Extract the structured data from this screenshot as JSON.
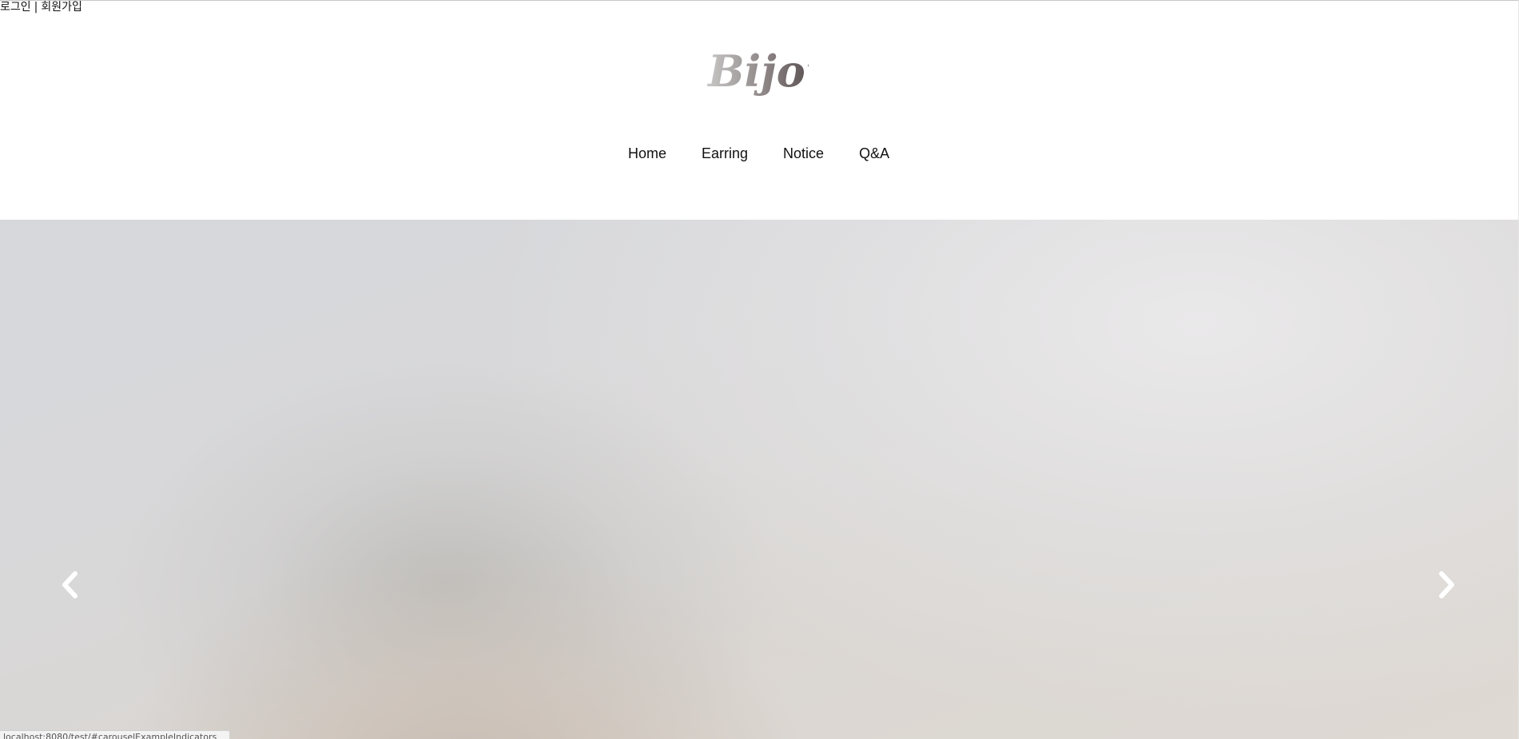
{
  "auth": {
    "login_label": "로그인",
    "separator": "|",
    "signup_label": "회원가입"
  },
  "brand": {
    "logo_text": "Bijou"
  },
  "nav": {
    "items": [
      {
        "label": "Home"
      },
      {
        "label": "Earring"
      },
      {
        "label": "Notice"
      },
      {
        "label": "Q&A"
      }
    ]
  },
  "carousel": {
    "prev_icon": "chevron-left-icon",
    "next_icon": "chevron-right-icon"
  },
  "status_bar": {
    "url": "localhost:8080/test/#carouselExampleIndicators"
  }
}
